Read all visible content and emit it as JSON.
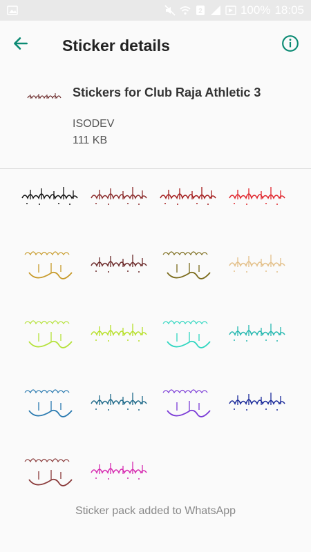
{
  "status_bar": {
    "battery_percent": "100%",
    "time": "18:05",
    "sim_badge": "2"
  },
  "toolbar": {
    "title": "Sticker details"
  },
  "pack": {
    "name": "Stickers for Club Raja Athletic 3",
    "publisher": "ISODEV",
    "size": "111 KB"
  },
  "stickers": [
    {
      "kind": "line",
      "color": "#111111"
    },
    {
      "kind": "line",
      "color": "#8a2a2a"
    },
    {
      "kind": "line",
      "color": "#a31b1b"
    },
    {
      "kind": "line",
      "color": "#e0242b"
    },
    {
      "kind": "block",
      "color": "#c79a2a"
    },
    {
      "kind": "line",
      "color": "#6b2a2a"
    },
    {
      "kind": "block",
      "color": "#7a6a1a"
    },
    {
      "kind": "line",
      "color": "#e3c08a"
    },
    {
      "kind": "block",
      "color": "#b5e23a"
    },
    {
      "kind": "line",
      "color": "#b7e02a"
    },
    {
      "kind": "block",
      "color": "#2fd6c0"
    },
    {
      "kind": "line",
      "color": "#27b8b0"
    },
    {
      "kind": "block",
      "color": "#2a7ab0"
    },
    {
      "kind": "line",
      "color": "#1f6a8a"
    },
    {
      "kind": "block",
      "color": "#7a3ad6"
    },
    {
      "kind": "line",
      "color": "#1a2a9a"
    },
    {
      "kind": "block",
      "color": "#8a3a3a"
    },
    {
      "kind": "line",
      "color": "#d62ab0"
    }
  ],
  "footer": {
    "message": "Sticker pack added to WhatsApp"
  },
  "colors": {
    "accent": "#0b8a73",
    "status_bar_bg": "#e9e9e9"
  }
}
